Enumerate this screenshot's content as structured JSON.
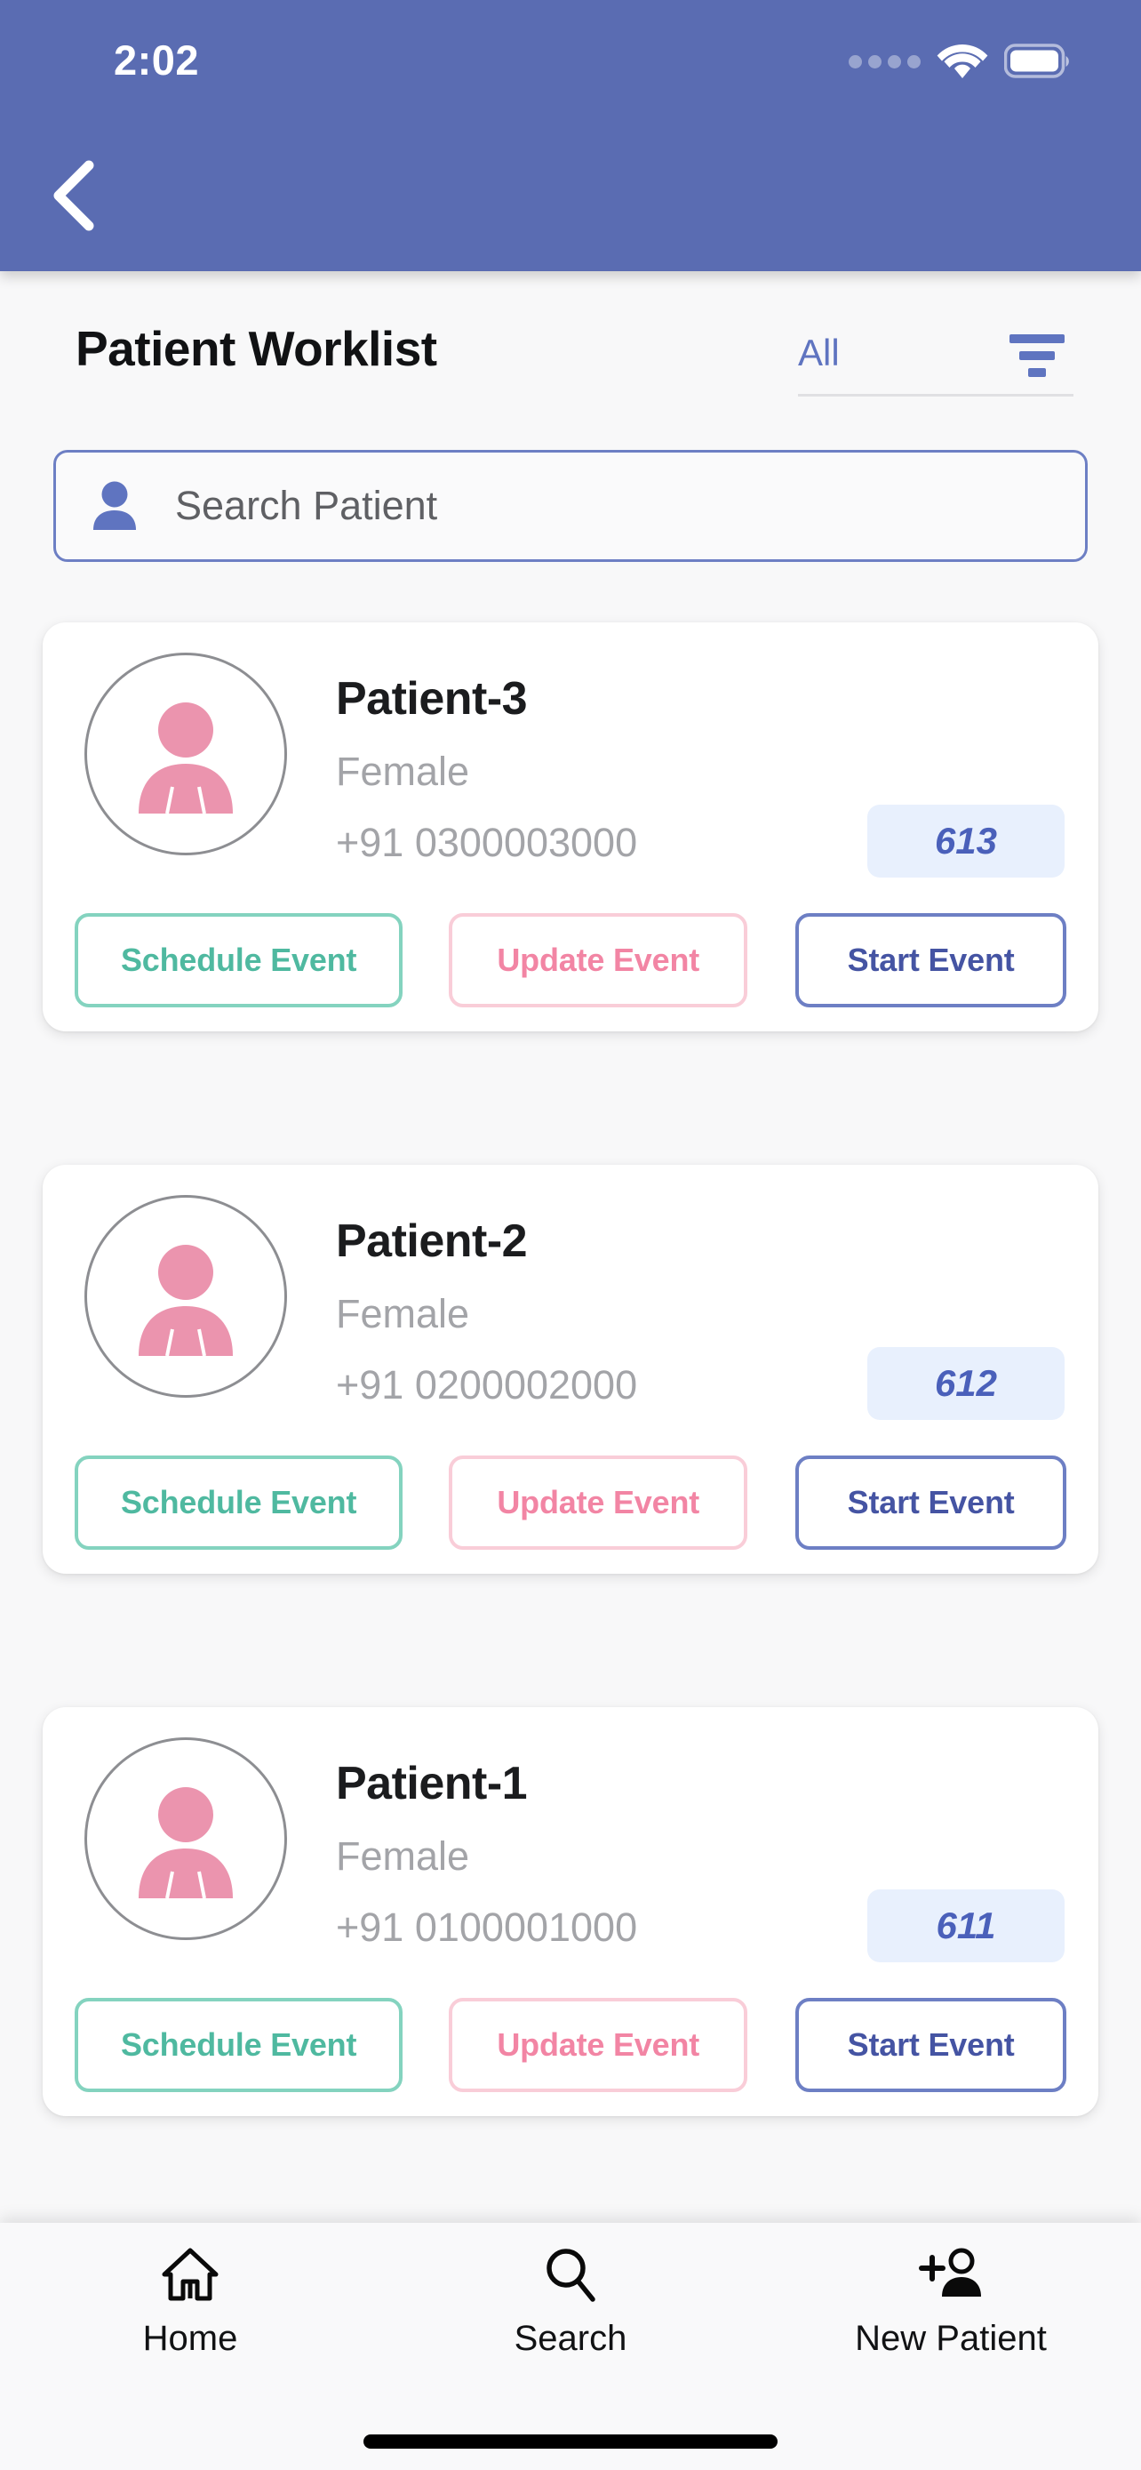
{
  "status_bar": {
    "time": "2:02",
    "cellular_icon": "cellular-dots-icon",
    "wifi_icon": "wifi-icon",
    "battery_icon": "battery-full-icon"
  },
  "app_bar": {
    "back_icon": "chevron-left-icon",
    "background_color": "#5a6cb2"
  },
  "header": {
    "title": "Patient Worklist",
    "filter_value": "All",
    "filter_icon": "filter-lines-icon",
    "filter_accent_color": "#5f74c0"
  },
  "search": {
    "placeholder": "Search Patient",
    "value": "",
    "icon": "person-icon",
    "border_color": "#6d7fc4"
  },
  "actions": {
    "schedule_label": "Schedule Event",
    "update_label": "Update Event",
    "start_label": "Start Event",
    "schedule_color": "#4fb9a0",
    "update_color": "#f285a4",
    "start_color": "#4554a3"
  },
  "patients": [
    {
      "name": "Patient-3",
      "gender": "Female",
      "phone": "+91 0300003000",
      "badge": "613",
      "avatar_icon": "female-patient-avatar-icon"
    },
    {
      "name": "Patient-2",
      "gender": "Female",
      "phone": "+91 0200002000",
      "badge": "612",
      "avatar_icon": "female-patient-avatar-icon"
    },
    {
      "name": "Patient-1",
      "gender": "Female",
      "phone": "+91 0100001000",
      "badge": "611",
      "avatar_icon": "female-patient-avatar-icon"
    }
  ],
  "bottom_nav": {
    "items": [
      {
        "label": "Home",
        "icon": "home-icon"
      },
      {
        "label": "Search",
        "icon": "search-icon"
      },
      {
        "label": "New Patient",
        "icon": "person-add-icon"
      }
    ]
  }
}
